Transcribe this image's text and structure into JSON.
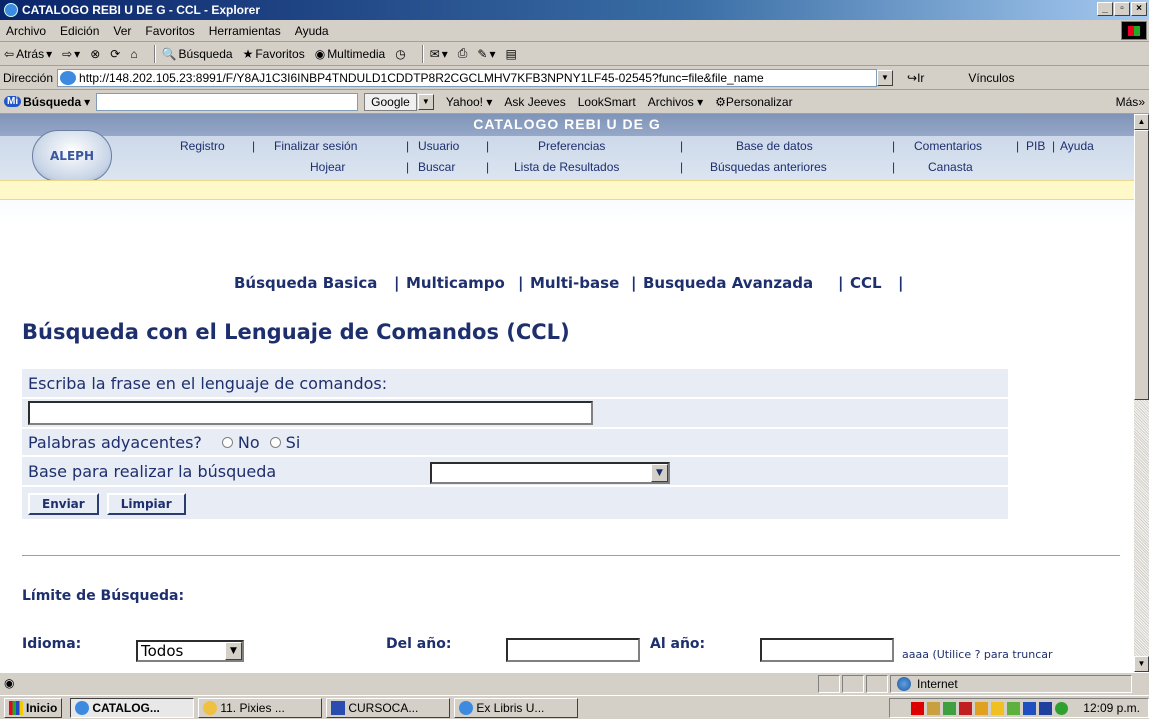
{
  "window": {
    "title": "CATALOGO REBI U DE G - CCL - Explorer"
  },
  "menu": [
    "Archivo",
    "Edición",
    "Ver",
    "Favoritos",
    "Herramientas",
    "Ayuda"
  ],
  "toolbar": {
    "back": "Atrás",
    "search": "Búsqueda",
    "favorites": "Favoritos",
    "media": "Multimedia"
  },
  "address": {
    "label": "Dirección",
    "url": "http://148.202.105.23:8991/F/Y8AJ1C3I6INBP4TNDULD1CDDTP8R2CGCLMHV7KFB3NPNY1LF45-02545?func=file&file_name",
    "go": "Ir",
    "links": "Vínculos"
  },
  "google_bar": {
    "mi": "Mi",
    "search_label": "Búsqueda",
    "google": "Google",
    "items": [
      "Yahoo!",
      "Ask Jeeves",
      "LookSmart",
      "Archivos",
      "Personalizar"
    ],
    "more": "Más"
  },
  "header": {
    "title": "CATALOGO REBI U DE G",
    "logo": "ALEPH",
    "nav1": [
      "Registro",
      "Finalizar sesión",
      "Usuario",
      "Preferencias",
      "Base de datos",
      "Comentarios",
      "PIB",
      "Ayuda"
    ],
    "nav2": [
      "Hojear",
      "Buscar",
      "Lista de Resultados",
      "Búsquedas anteriores",
      "Canasta"
    ]
  },
  "search_links": [
    "Búsqueda Basica",
    "Multicampo",
    "Multi-base",
    "Busqueda Avanzada",
    "CCL"
  ],
  "page_title": "Búsqueda con el Lenguaje de Comandos (CCL)",
  "form": {
    "command_label": "Escriba la frase en el lenguaje de comandos:",
    "command_value": "",
    "adjacent_label": "Palabras adyacentes?",
    "radio_no": "No",
    "radio_si": "Si",
    "base_label": "Base para realizar la búsqueda",
    "base_value": "",
    "submit": "Enviar",
    "clear": "Limpiar"
  },
  "limits": {
    "title": "Límite de Búsqueda:",
    "language_label": "Idioma:",
    "language_value": "Todos",
    "from_year_label": "Del año:",
    "to_year_label": "Al año:",
    "hint": "aaaa (Utilice ? para truncar"
  },
  "status": {
    "zone": "Internet"
  },
  "taskbar": {
    "start": "Inicio",
    "tasks": [
      "CATALOG...",
      "11. Pixies ...",
      "CURSOCA...",
      "Ex Libris U..."
    ],
    "clock": "12:09 p.m."
  }
}
